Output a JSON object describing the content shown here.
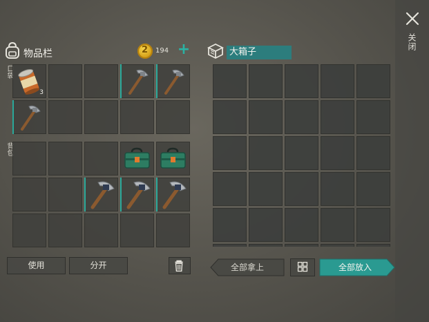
{
  "side_panel": {
    "close_label": "关闭"
  },
  "inventory": {
    "title": "物品栏",
    "coins": "194",
    "add_symbol": "+",
    "pocket_label": "口袋",
    "backpack_label": "背包",
    "pocket_slots": [
      {
        "item": "canned-food",
        "qty": "3"
      },
      {
        "item": ""
      },
      {
        "item": ""
      },
      {
        "item": "pickaxe-small"
      },
      {
        "item": "pickaxe-small"
      },
      {
        "item": "pickaxe-small"
      },
      {
        "item": ""
      },
      {
        "item": ""
      },
      {
        "item": ""
      },
      {
        "item": ""
      }
    ],
    "backpack_slots": [
      {
        "item": ""
      },
      {
        "item": ""
      },
      {
        "item": ""
      },
      {
        "item": "toolbox"
      },
      {
        "item": "toolbox"
      },
      {
        "item": ""
      },
      {
        "item": ""
      },
      {
        "item": "pickaxe-large"
      },
      {
        "item": "pickaxe-large"
      },
      {
        "item": "pickaxe-large"
      },
      {
        "item": ""
      },
      {
        "item": ""
      },
      {
        "item": ""
      },
      {
        "item": ""
      },
      {
        "item": ""
      }
    ],
    "use_button": "使用",
    "split_button": "分开"
  },
  "chest": {
    "name": "大箱子",
    "take_all_button": "全部拿上",
    "put_all_button": "全部放入"
  },
  "colors": {
    "accent": "#2aa99a",
    "chest_name_bg": "#2c7d7d"
  }
}
